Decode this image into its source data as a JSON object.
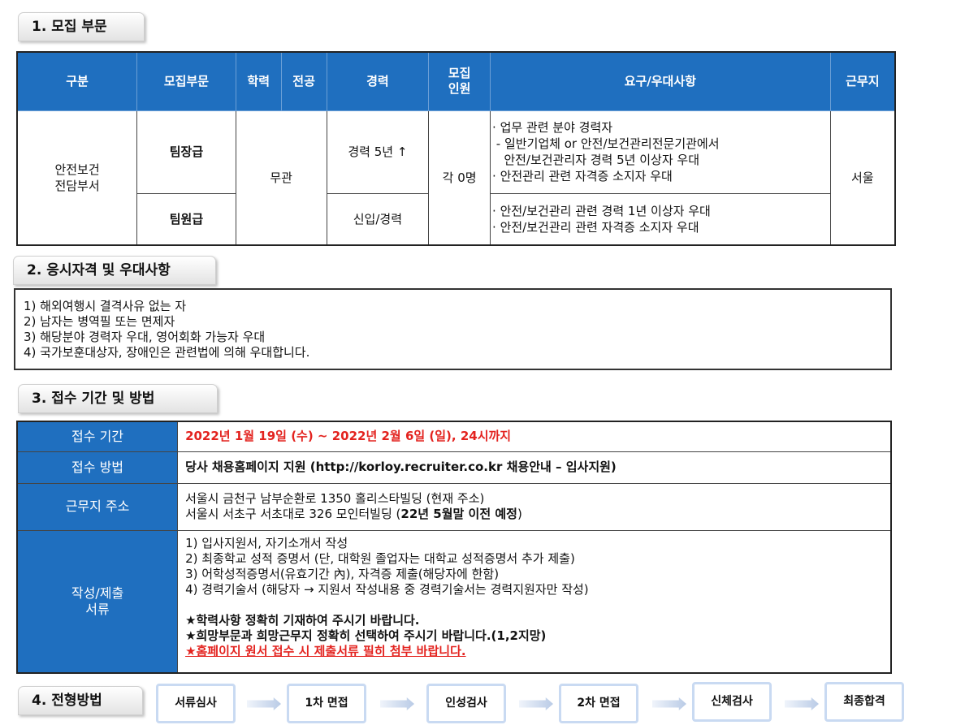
{
  "section1": {
    "title": "1. 모집 부문",
    "headers": {
      "category": "구분",
      "recruit_field": "모집부문",
      "education": "학력",
      "major": "전공",
      "experience": "경력",
      "headcount_line1": "모집",
      "headcount_line2": "인원",
      "requirements": "요구/우대사항",
      "location": "근무지"
    },
    "department_line1": "안전보건",
    "department_line2": "전담부서",
    "education_major": "무관",
    "headcount": "각 0명",
    "location": "서울",
    "rows": [
      {
        "field": "팀장급",
        "experience": "경력 5년 ↑",
        "requirements": [
          "· 업무 관련 분야 경력자",
          " - 일반기업체 or 안전/보건관리전문기관에서",
          "   안전/보건관리자 경력 5년 이상자 우대",
          "· 안전관리 관련 자격증 소지자 우대"
        ]
      },
      {
        "field": "팀원급",
        "experience": "신입/경력",
        "requirements": [
          "· 안전/보건관리 관련 경력 1년 이상자 우대",
          "· 안전/보건관리 관련 자격증 소지자 우대"
        ]
      }
    ]
  },
  "section2": {
    "title": "2. 응시자격 및 우대사항",
    "items": [
      "1) 해외여행시 결격사유 없는 자",
      "2) 남자는 병역필 또는 면제자",
      "3) 해당분야 경력자 우대, 영어회화 가능자 우대",
      "4) 국가보훈대상자, 장애인은 관련법에 의해 우대합니다."
    ]
  },
  "section3": {
    "title": "3. 접수 기간 및 방법",
    "period_label": "접수 기간",
    "period_value": "2022년 1월 19일 (수) ~ 2022년 2월 6일 (일), 24시까지",
    "method_label": "접수 방법",
    "method_value": "당사 채용홈페이지 지원 (http://korloy.recruiter.co.kr 채용안내 – 입사지원)",
    "address_label": "근무지 주소",
    "address_line1": "서울시 금천구 남부순환로 1350 홀리스타빌딩 (현재 주소)",
    "address_line2_prefix": "서울시 서초구 서초대로 326 모인터빌딩 (",
    "address_line2_bold": "22년 5월말 이전 예정",
    "address_line2_suffix": ")",
    "docs_label_line1": "작성/제출",
    "docs_label_line2": "서류",
    "docs_items": [
      "1) 입사지원서, 자기소개서 작성",
      "2) 최종학교 성적 증명서 (단, 대학원 졸업자는 대학교 성적증명서 추가 제출)",
      "3) 어학성적증명서(유효기간 內), 자격증 제출(해당자에 한함)",
      "4) 경력기술서 (해당자 → 지원서 작성내용 중 경력기술서는 경력지원자만 작성)"
    ],
    "notes": [
      "★학력사항 정확히 기재하여 주시기 바랍니다.",
      "★희망부문과 희망근무지 정확히 선택하여 주시기 바랍니다.(1,2지망)"
    ],
    "red_note": "★홈페이지 원서 접수 시 제출서류 필히 첨부 바랍니다."
  },
  "section4": {
    "title": "4. 전형방법",
    "steps": [
      "서류심사",
      "1차 면접",
      "인성검사",
      "2차 면접",
      "신체검사",
      "최종합격"
    ]
  },
  "colors": {
    "header_blue": "#1f6fbf",
    "accent_red": "#e3231f",
    "step_border": "#c9daf2"
  }
}
